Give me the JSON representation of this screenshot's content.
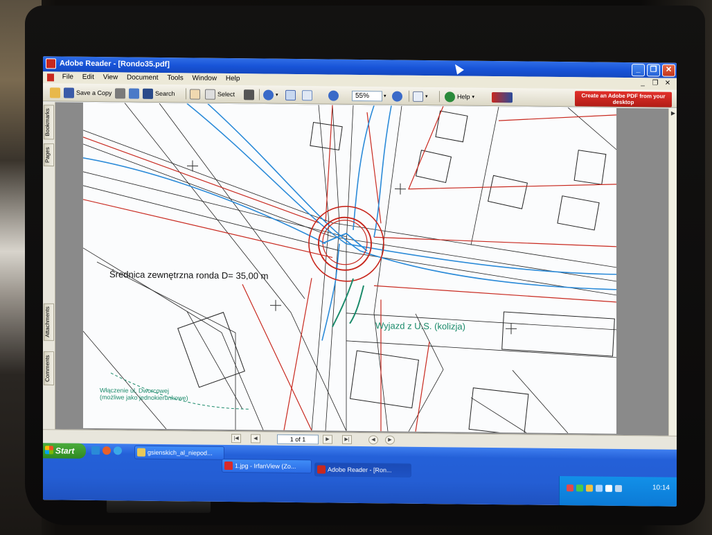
{
  "window": {
    "title": "Adobe Reader - [Rondo35.pdf]",
    "buttons": {
      "minimize": "_",
      "maximize": "❐",
      "close": "✕"
    }
  },
  "menu": [
    "File",
    "Edit",
    "View",
    "Document",
    "Tools",
    "Window",
    "Help"
  ],
  "toolbar": {
    "save_copy": "Save a Copy",
    "search": "Search",
    "select": "Select",
    "zoom": "55%",
    "help": "Help",
    "promo": "Create an Adobe PDF from your desktop"
  },
  "nav_tabs": [
    "Bookmarks",
    "Pages",
    "Attachments",
    "Comments"
  ],
  "document": {
    "diameter_label": "Średnica zewnętrzna ronda D= 35,00 m",
    "exit_label": "Wyjazd z U.S. (kolizja)",
    "junction_label_1": "Włączenie ul. Dworcowej",
    "junction_label_2": "(możliwe jako jednokierunkowe)"
  },
  "status": {
    "page": "1 of 1"
  },
  "taskbar": {
    "start": "Start",
    "tasks": [
      "gsienskich_al_niepod...",
      "1.jpg - IrfanView (Zo...",
      "Adobe Reader - [Ron..."
    ],
    "clock": "10:14"
  },
  "colors": {
    "xp_blue": "#245ed4",
    "adobe_red": "#c8281e",
    "map_red": "#c8281e",
    "map_blue": "#2a8ad8",
    "map_green": "#1a8a6a"
  }
}
